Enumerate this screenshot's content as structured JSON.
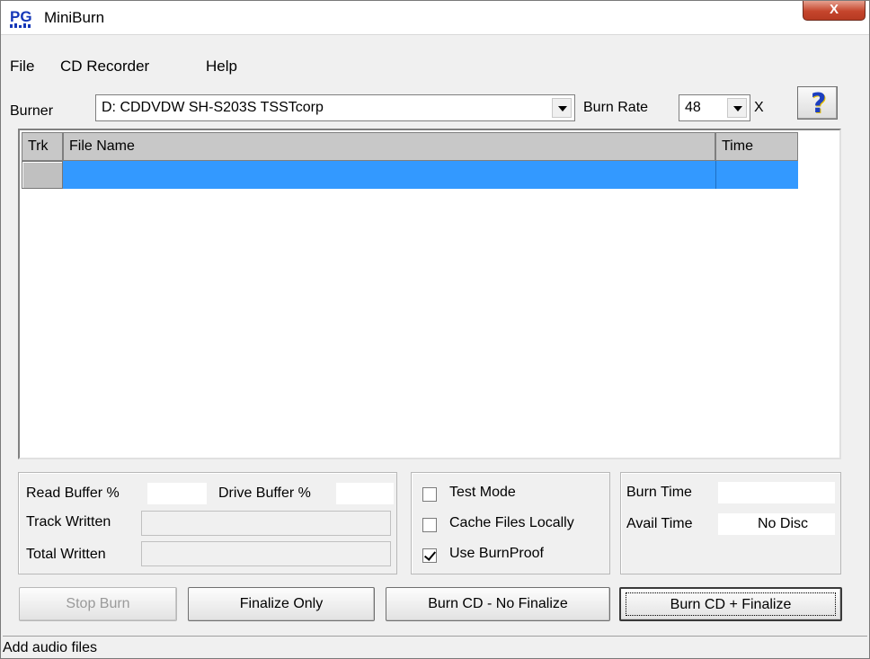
{
  "window": {
    "title": "MiniBurn",
    "logo_text": "PG",
    "close_glyph": "X"
  },
  "menu": {
    "items": [
      {
        "label": "File"
      },
      {
        "label": "CD Recorder"
      },
      {
        "label": "Help"
      }
    ]
  },
  "burner": {
    "label": "Burner",
    "selected": "D: CDDVDW SH-S203S  TSSTcorp",
    "rate_label": "Burn Rate",
    "rate_value": "48",
    "rate_unit": "X",
    "help_glyph": "?"
  },
  "track_list": {
    "columns": [
      {
        "label": "Trk"
      },
      {
        "label": "File Name"
      },
      {
        "label": "Time"
      }
    ],
    "rows": [
      {
        "trk": "",
        "file_name": "",
        "time": "",
        "selected": true
      }
    ]
  },
  "buffers": {
    "read_buffer_label": "Read Buffer %",
    "drive_buffer_label": "Drive Buffer %",
    "track_written_label": "Track Written",
    "total_written_label": "Total Written"
  },
  "options": {
    "test_mode": {
      "label": "Test Mode",
      "checked": false
    },
    "cache_files": {
      "label": "Cache Files Locally",
      "checked": false
    },
    "burnproof": {
      "label": "Use BurnProof",
      "checked": true
    }
  },
  "times": {
    "burn_time_label": "Burn Time",
    "burn_time_value": "",
    "avail_time_label": "Avail Time",
    "avail_time_value": "No Disc"
  },
  "actions": {
    "stop": "Stop Burn",
    "finalize_only": "Finalize Only",
    "burn_no_finalize": "Burn CD - No Finalize",
    "burn_finalize": "Burn CD + Finalize"
  },
  "status": {
    "text": "Add audio files"
  },
  "colors": {
    "selection": "#3399ff",
    "help_icon": "#1d3fbf",
    "close_button": "#c5452c"
  }
}
